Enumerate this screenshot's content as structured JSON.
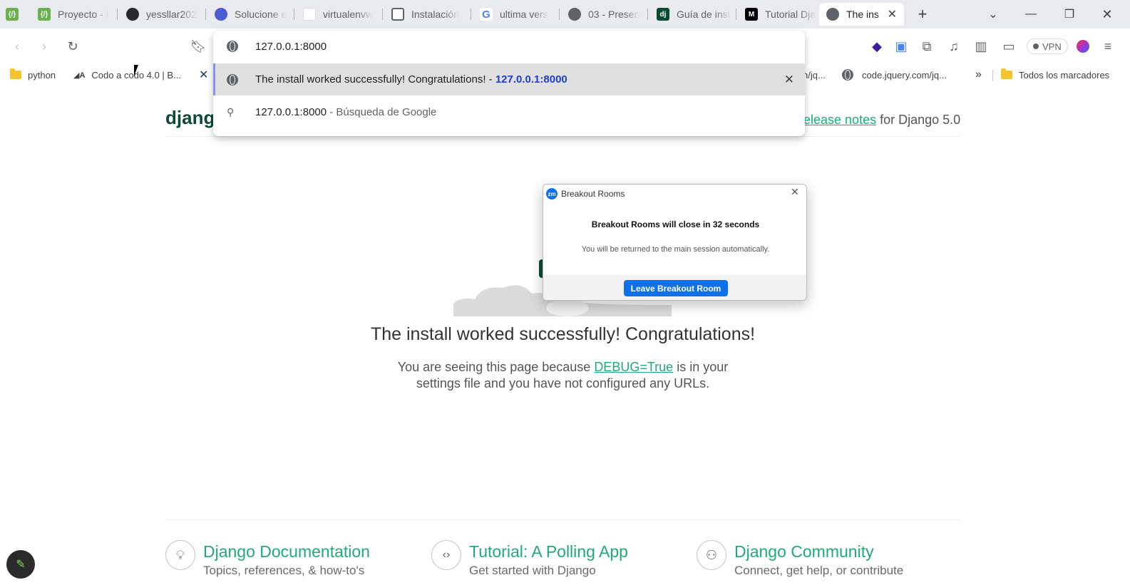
{
  "tabs": [
    {
      "title": "",
      "icon": "code-bracket-icon",
      "color": "#6ab04c"
    },
    {
      "title": "Proyecto - I",
      "icon": "code-bracket-icon",
      "color": "#6ab04c"
    },
    {
      "title": "yessllar202",
      "icon": "github-icon",
      "color": "#24292e"
    },
    {
      "title": "Solucione e",
      "icon": "gear-badge-icon",
      "color": "#4a5bd4"
    },
    {
      "title": "virtualenvw",
      "icon": "blank-page-icon",
      "color": "#ffffff"
    },
    {
      "title": "Instalación",
      "icon": "document-icon",
      "color": "#5f6368"
    },
    {
      "title": "ultima vers",
      "icon": "google-icon",
      "color": "#4285f4"
    },
    {
      "title": "03 - Presen",
      "icon": "globe-icon",
      "color": "#5f6368"
    },
    {
      "title": "Guía de inst",
      "icon": "django-icon",
      "color": "#0c4b33"
    },
    {
      "title": "Tutorial Dja",
      "icon": "medium-icon",
      "color": "#000000"
    },
    {
      "title": "The ins",
      "icon": "globe-icon",
      "color": "#5f6368"
    }
  ],
  "toolbar": {
    "address": "127.0.0.1:8000",
    "vpn_label": "VPN"
  },
  "bookmarks": [
    {
      "label": "python",
      "icon": "folder-icon"
    },
    {
      "label": "Codo a codo 4.0 | B...",
      "icon": "codo-icon"
    },
    {
      "label": "n/jq...",
      "icon": ""
    },
    {
      "label": "code.jquery.com/jq...",
      "icon": "globe-icon"
    },
    {
      "label": "Todos los marcadores",
      "icon": "folder-icon"
    }
  ],
  "omnibox": {
    "suggestion1_title": "The install worked successfully! Congratulations!",
    "suggestion1_sep": " - ",
    "suggestion1_url": "127.0.0.1:8000",
    "suggestion2_query": "127.0.0.1:8000",
    "suggestion2_suffix": " - Búsqueda de Google"
  },
  "django": {
    "logo": "djang",
    "release_link": "elease notes",
    "release_suffix": " for Django 5.0",
    "headline": "The install worked successfully! Congratulations!",
    "body_prefix": "You are seeing this page because ",
    "debug_link": "DEBUG=True",
    "body_suffix": " is in your",
    "body_line2": "settings file and you have not configured any URLs.",
    "cards": [
      {
        "title": "Django Documentation",
        "subtitle": "Topics, references, & how-to's",
        "icon": "lightbulb-icon"
      },
      {
        "title": "Tutorial: A Polling App",
        "subtitle": "Get started with Django",
        "icon": "code-brackets-icon"
      },
      {
        "title": "Django Community",
        "subtitle": "Connect, get help, or contribute",
        "icon": "people-icon"
      }
    ]
  },
  "breakout": {
    "window_title": "Breakout Rooms",
    "app_badge": "zm",
    "heading": "Breakout Rooms will close in 32 seconds",
    "message": "You will be returned to the main session automatically.",
    "button": "Leave Breakout Room"
  }
}
